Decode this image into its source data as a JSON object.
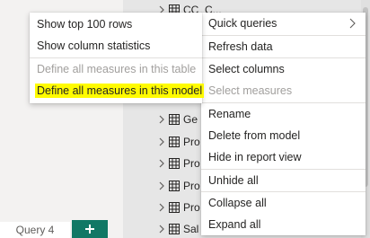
{
  "colors": {
    "highlight": "#fffb00",
    "accent_tab": "#117865",
    "disabled_text": "#a19f9d"
  },
  "tree": {
    "rows": [
      {
        "label": "CC_C..."
      },
      {
        "label": "Ge"
      },
      {
        "label": "Pro"
      },
      {
        "label": "Pro"
      },
      {
        "label": "Pro"
      },
      {
        "label": "Pro"
      },
      {
        "label": "Sal"
      }
    ]
  },
  "bottom": {
    "tab_label": "Query 4",
    "add_label": "+"
  },
  "left_menu": {
    "items": [
      {
        "label": "Show top 100 rows",
        "enabled": true
      },
      {
        "label": "Show column statistics",
        "enabled": true
      },
      {
        "label": "Define all measures in this table",
        "enabled": false
      },
      {
        "label": "Define all measures in this model",
        "enabled": true,
        "highlighted": true
      }
    ]
  },
  "right_menu": {
    "items": [
      {
        "label": "Quick queries",
        "enabled": true,
        "submenu": true
      },
      {
        "label": "Refresh data",
        "enabled": true
      },
      {
        "label": "Select columns",
        "enabled": true
      },
      {
        "label": "Select measures",
        "enabled": false
      },
      {
        "label": "Rename",
        "enabled": true
      },
      {
        "label": "Delete from model",
        "enabled": true
      },
      {
        "label": "Hide in report view",
        "enabled": true
      },
      {
        "label": "Unhide all",
        "enabled": true
      },
      {
        "label": "Collapse all",
        "enabled": true
      },
      {
        "label": "Expand all",
        "enabled": true
      }
    ]
  }
}
